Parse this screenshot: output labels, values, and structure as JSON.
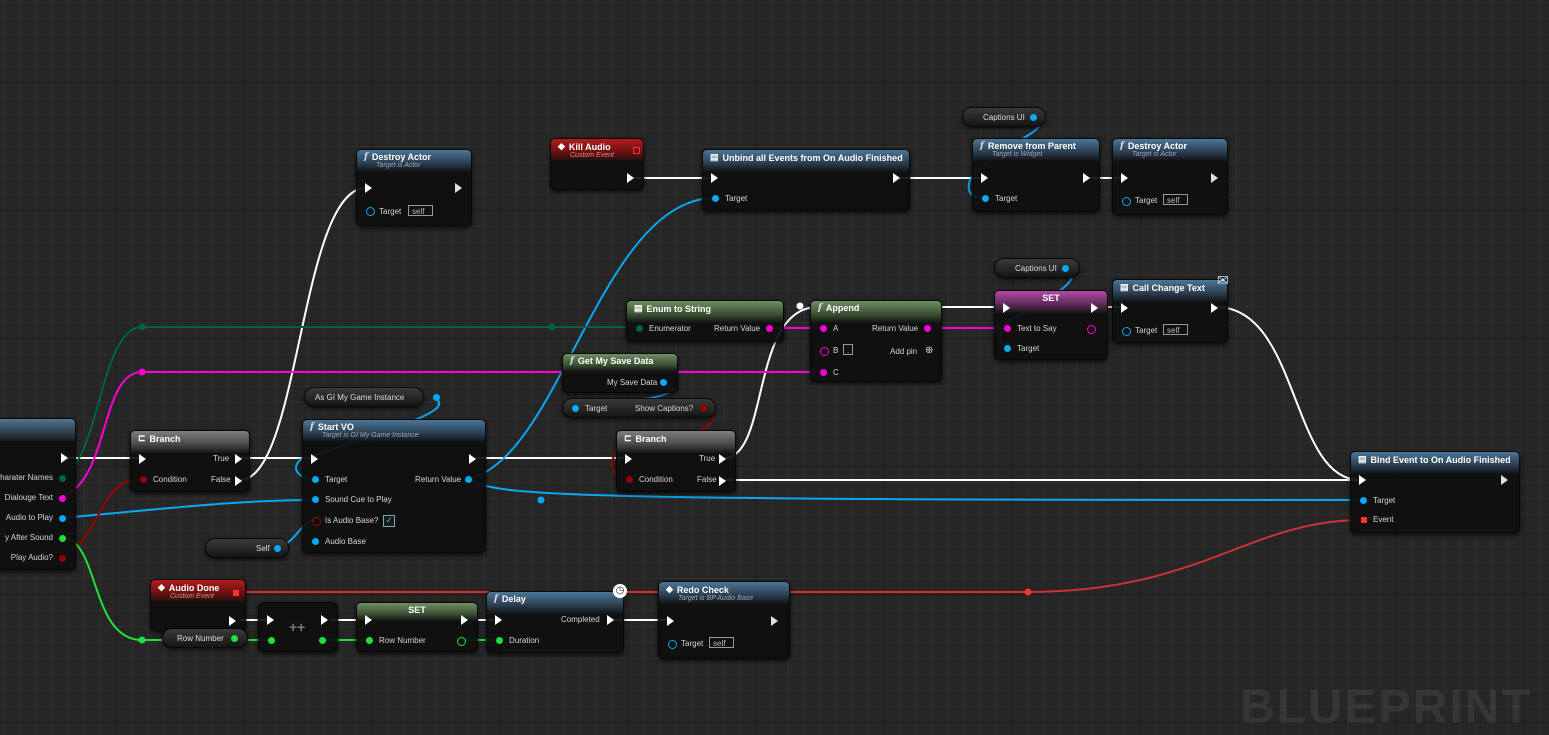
{
  "watermark": "BLUEPRINT",
  "colors": {
    "exec": "#ffffff",
    "object": "#0aa8f3",
    "string": "#ff00d4",
    "bool": "#950000",
    "integer": "#1fe03c",
    "enum": "#00604a",
    "event": "#ff3030"
  },
  "nodes": {
    "event_partial": {
      "pins": [
        "harater Names",
        "Dialouge Text",
        "Audio to Play",
        "y After Sound",
        "Play Audio?"
      ]
    },
    "branch1": {
      "title": "Branch",
      "condition": "Condition",
      "true": "True",
      "false": "False"
    },
    "destroy1": {
      "title": "Destroy Actor",
      "subtitle": "Target is Actor",
      "target": "Target",
      "self": "self"
    },
    "as_gi": {
      "label": "As GI My Game Instance"
    },
    "start_vo": {
      "title": "Start VO",
      "subtitle": "Target is GI My Game Instance",
      "target": "Target",
      "return_value": "Return Value",
      "sound_cue": "Sound Cue to Play",
      "is_audio_base": "Is Audio Base?",
      "audio_base": "Audio Base"
    },
    "self_pill": {
      "label": "Self"
    },
    "kill_audio": {
      "title": "Kill Audio",
      "subtitle": "Custom Event"
    },
    "unbind": {
      "title": "Unbind all Events from On Audio Finished",
      "target": "Target"
    },
    "captions1": {
      "label": "Captions UI"
    },
    "remove_parent": {
      "title": "Remove from Parent",
      "subtitle": "Target is Widget",
      "target": "Target"
    },
    "destroy2": {
      "title": "Destroy Actor",
      "subtitle": "Target is Actor",
      "target": "Target",
      "self": "self"
    },
    "enum_string": {
      "title": "Enum to String",
      "enumerator": "Enumerator",
      "return_value": "Return Value"
    },
    "append": {
      "title": "Append",
      "a": "A",
      "b": "B",
      "b_value": ".",
      "c": "C",
      "return_value": "Return Value",
      "add_pin": "Add pin"
    },
    "get_save": {
      "title": "Get My Save Data",
      "output": "My Save Data"
    },
    "show_captions": {
      "target": "Target",
      "output": "Show Captions?"
    },
    "branch2": {
      "title": "Branch",
      "condition": "Condition",
      "true": "True",
      "false": "False"
    },
    "captions2": {
      "label": "Captions UI"
    },
    "set_text": {
      "title": "SET",
      "text_to_say": "Text to Say",
      "target": "Target"
    },
    "call_change": {
      "title": "Call Change Text",
      "target": "Target",
      "self": "self"
    },
    "bind_event": {
      "title": "Bind Event to On Audio Finished",
      "target": "Target",
      "event": "Event"
    },
    "audio_done": {
      "title": "Audio Done",
      "subtitle": "Custom Event"
    },
    "row_get": {
      "label": "Row Number"
    },
    "increment": {
      "label": "++"
    },
    "set_row": {
      "title": "SET",
      "row": "Row Number"
    },
    "delay": {
      "title": "Delay",
      "completed": "Completed",
      "duration": "Duration"
    },
    "redo": {
      "title": "Redo Check",
      "subtitle": "Target is BP Audio Base",
      "target": "Target",
      "self": "self"
    }
  }
}
